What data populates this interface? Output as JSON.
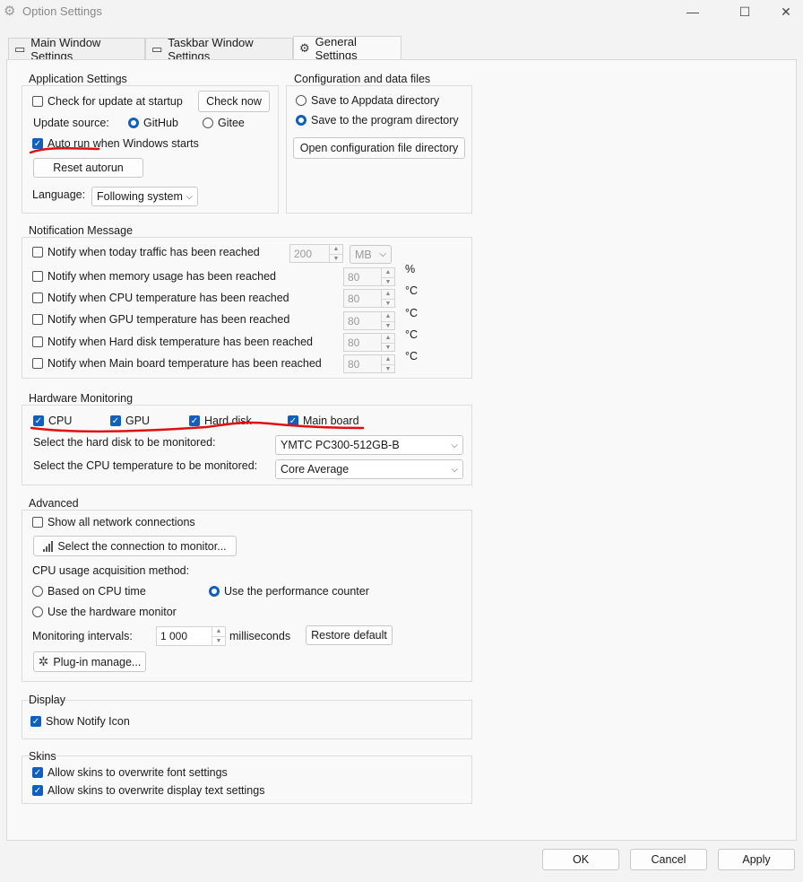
{
  "window": {
    "title": "Option Settings",
    "minimize": "—",
    "maximize": "☐",
    "close": "✕"
  },
  "tabs": [
    {
      "label": "Main Window Settings"
    },
    {
      "label": "Taskbar Window Settings"
    },
    {
      "label": "General Settings"
    }
  ],
  "app_settings": {
    "title": "Application Settings",
    "check_update": "Check for update at startup",
    "check_now": "Check now",
    "update_source_label": "Update source:",
    "github": "GitHub",
    "gitee": "Gitee",
    "auto_run": "Auto run when Windows starts",
    "reset_autorun": "Reset autorun",
    "language_label": "Language:",
    "language_value": "Following system"
  },
  "config": {
    "title": "Configuration and data files",
    "appdata": "Save to Appdata directory",
    "program_dir": "Save to the program directory",
    "open_dir": "Open configuration file directory"
  },
  "notify": {
    "title": "Notification Message",
    "traffic": "Notify when today traffic has been reached",
    "traffic_value": "200",
    "traffic_unit": "MB",
    "memory": "Notify when memory usage has been reached",
    "memory_value": "80",
    "memory_unit": "%",
    "cpu": "Notify when CPU temperature has been reached",
    "cpu_value": "80",
    "gpu": "Notify when GPU temperature has been reached",
    "gpu_value": "80",
    "hdd": "Notify when Hard disk temperature has been reached",
    "hdd_value": "80",
    "mb": "Notify when Main board temperature has been reached",
    "mb_value": "80",
    "temp_unit": "°C"
  },
  "hardware": {
    "title": "Hardware Monitoring",
    "cpu": "CPU",
    "gpu": "GPU",
    "hdd": "Hard disk",
    "mainboard": "Main board",
    "disk_label": "Select the hard disk to be monitored:",
    "disk_value": "YMTC PC300-512GB-B",
    "cpu_temp_label": "Select the CPU temperature to be monitored:",
    "cpu_temp_value": "Core Average"
  },
  "advanced": {
    "title": "Advanced",
    "show_all": "Show all network connections",
    "select_conn": "Select the connection to monitor...",
    "cpu_method_label": "CPU usage acquisition method:",
    "cpu_time": "Based on CPU time",
    "perf_counter": "Use the performance counter",
    "hw_monitor": "Use the hardware monitor",
    "interval_label": "Monitoring intervals:",
    "interval_value": "1 000",
    "interval_unit": "milliseconds",
    "restore": "Restore default",
    "plugin": "Plug-in manage..."
  },
  "display": {
    "title": "Display",
    "notify_icon": "Show Notify Icon"
  },
  "skins": {
    "title": "Skins",
    "font": "Allow skins to overwrite font settings",
    "text": "Allow skins to overwrite display text settings"
  },
  "footer": {
    "ok": "OK",
    "cancel": "Cancel",
    "apply": "Apply"
  },
  "colors": {
    "accent": "#0f5fc0",
    "annotation": "#e01010"
  }
}
